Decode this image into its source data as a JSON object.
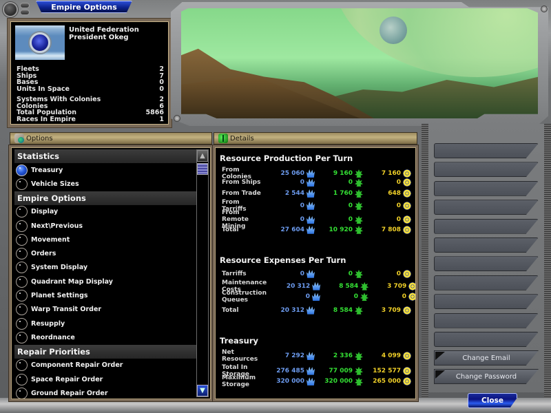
{
  "window": {
    "title": "Empire Options"
  },
  "empire": {
    "name": "United Federation",
    "leader": "President Okeg",
    "stats_group1": [
      {
        "label": "Fleets",
        "value": "2"
      },
      {
        "label": "Ships",
        "value": "7"
      },
      {
        "label": "Bases",
        "value": "0"
      },
      {
        "label": "Units In Space",
        "value": "0"
      }
    ],
    "stats_group2": [
      {
        "label": "Systems With Colonies",
        "value": "2"
      },
      {
        "label": "Colonies",
        "value": "6"
      },
      {
        "label": "Total Population",
        "value": "5866"
      },
      {
        "label": "Races In Empire",
        "value": "1"
      }
    ]
  },
  "options": {
    "header": "Options",
    "sections": [
      {
        "title": "Statistics",
        "items": [
          {
            "label": "Treasury",
            "selected": true
          },
          {
            "label": "Vehicle Sizes",
            "selected": false
          }
        ]
      },
      {
        "title": "Empire Options",
        "items": [
          {
            "label": "Display",
            "selected": false
          },
          {
            "label": "Next\\Previous",
            "selected": false
          },
          {
            "label": "Movement",
            "selected": false
          },
          {
            "label": "Orders",
            "selected": false
          },
          {
            "label": "System Display",
            "selected": false
          },
          {
            "label": "Quadrant Map Display",
            "selected": false
          },
          {
            "label": "Planet Settings",
            "selected": false
          },
          {
            "label": "Warp Transit Order",
            "selected": false
          },
          {
            "label": "Resupply",
            "selected": false
          },
          {
            "label": "Reordnance",
            "selected": false
          }
        ]
      },
      {
        "title": "Repair Priorities",
        "items": [
          {
            "label": "Component Repair Order",
            "selected": false
          },
          {
            "label": "Space Repair Order",
            "selected": false
          },
          {
            "label": "Ground Repair Order",
            "selected": false
          }
        ]
      }
    ]
  },
  "details": {
    "header": "Details",
    "resource_icons": {
      "minerals": "crystal-icon",
      "organics": "organics-icon",
      "radioactives": "radioactives-icon"
    },
    "colors": {
      "minerals": "#6d9cf0",
      "organics": "#34e034",
      "radioactives": "#f0d028"
    },
    "production": {
      "title": "Resource Production Per Turn",
      "rows": [
        {
          "label": "From Colonies",
          "minerals": "25 060",
          "organics": "9 160",
          "radioactives": "7 160"
        },
        {
          "label": "From Ships",
          "minerals": "0",
          "organics": "0",
          "radioactives": "0"
        },
        {
          "label": "From Trade",
          "minerals": "2 544",
          "organics": "1 760",
          "radioactives": "648"
        },
        {
          "label": "From Tarriffs",
          "minerals": "0",
          "organics": "0",
          "radioactives": "0"
        },
        {
          "label": "From Remote Mining",
          "minerals": "0",
          "organics": "0",
          "radioactives": "0"
        }
      ],
      "total": {
        "label": "Total",
        "minerals": "27 604",
        "organics": "10 920",
        "radioactives": "7 808"
      }
    },
    "expenses": {
      "title": "Resource Expenses Per Turn",
      "rows": [
        {
          "label": "Tarriffs",
          "minerals": "0",
          "organics": "0",
          "radioactives": "0"
        },
        {
          "label": "Maintenance Costs",
          "minerals": "20 312",
          "organics": "8 584",
          "radioactives": "3 709"
        },
        {
          "label": "Construction Queues",
          "minerals": "0",
          "organics": "0",
          "radioactives": "0"
        }
      ],
      "total": {
        "label": "Total",
        "minerals": "20 312",
        "organics": "8 584",
        "radioactives": "3 709"
      }
    },
    "treasury": {
      "title": "Treasury",
      "net": {
        "label": "Net Resources",
        "minerals": "7 292",
        "organics": "2 336",
        "radioactives": "4 099"
      },
      "storage": [
        {
          "label": "Total In Storage",
          "minerals": "276 485",
          "organics": "77 009",
          "radioactives": "152 577"
        },
        {
          "label": "Maximum Storage",
          "minerals": "320 000",
          "organics": "320 000",
          "radioactives": "265 000"
        }
      ]
    }
  },
  "right_panel": {
    "empty_slots": 11,
    "buttons": {
      "change_email": "Change Email",
      "change_password": "Change Password"
    }
  },
  "footer": {
    "close_label": "Close"
  }
}
